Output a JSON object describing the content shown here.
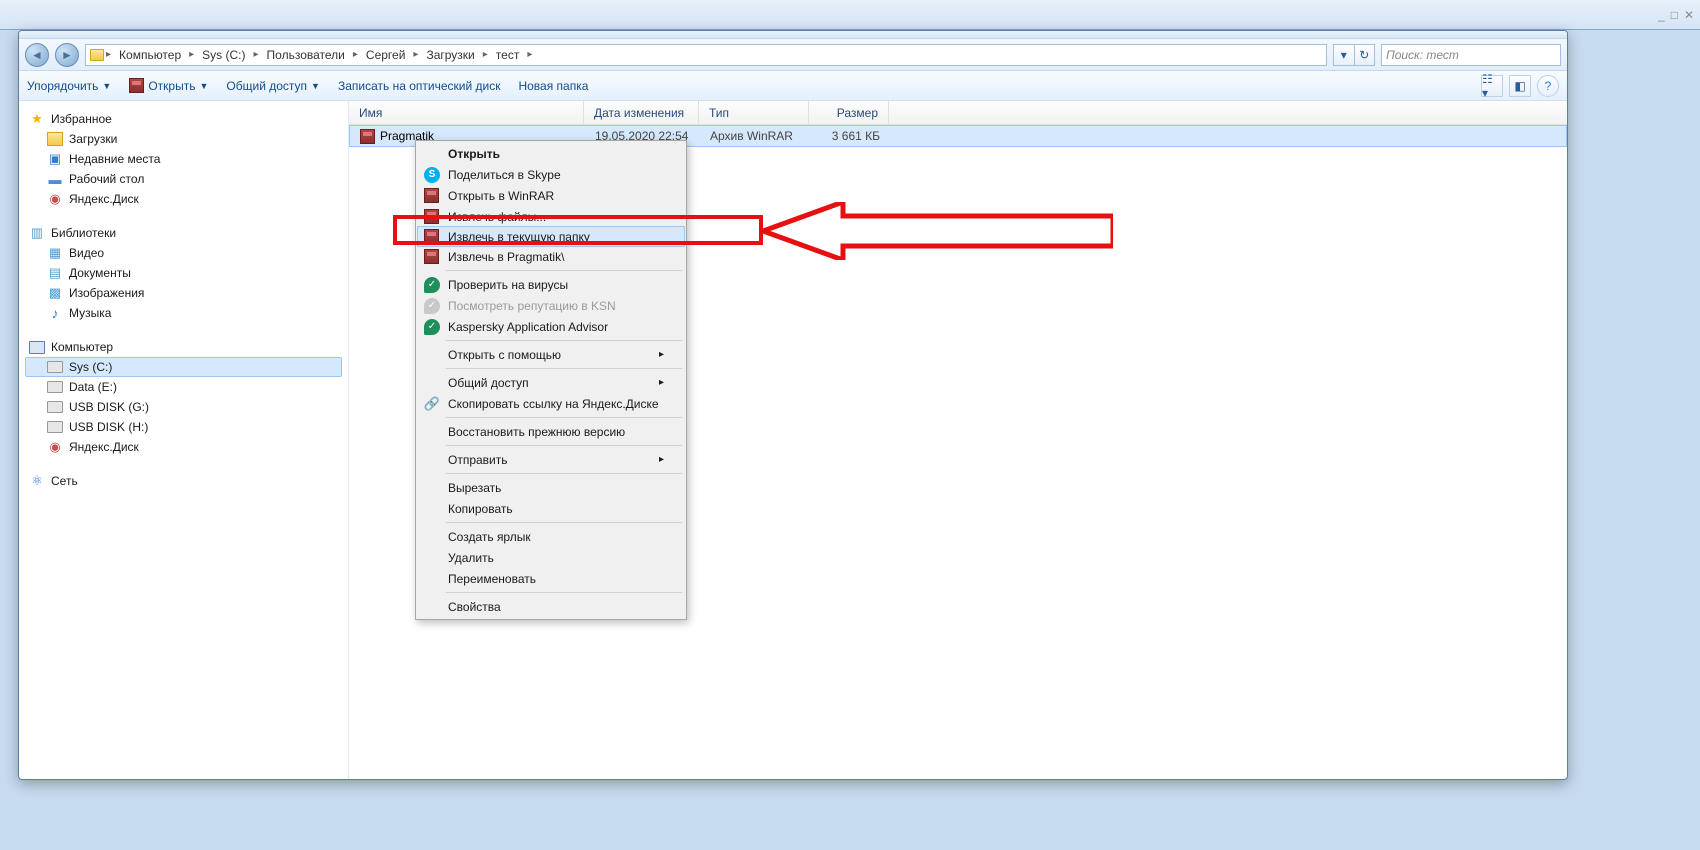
{
  "browserChrome": {
    "title": ""
  },
  "breadcrumb": {
    "items": [
      "Компьютер",
      "Sys (C:)",
      "Пользователи",
      "Сергей",
      "Загрузки",
      "тест"
    ]
  },
  "search": {
    "placeholder": "Поиск: тест"
  },
  "toolbar": {
    "organize": "Упорядочить",
    "open": "Открыть",
    "share": "Общий доступ",
    "burn": "Записать на оптический диск",
    "newfolder": "Новая папка"
  },
  "sidebar": {
    "favorites": {
      "label": "Избранное",
      "items": [
        "Загрузки",
        "Недавние места",
        "Рабочий стол",
        "Яндекс.Диск"
      ]
    },
    "libraries": {
      "label": "Библиотеки",
      "items": [
        "Видео",
        "Документы",
        "Изображения",
        "Музыка"
      ]
    },
    "computer": {
      "label": "Компьютер",
      "items": [
        "Sys (C:)",
        "Data (E:)",
        "USB DISK (G:)",
        "USB DISK (H:)",
        "Яндекс.Диск"
      ]
    },
    "network": {
      "label": "Сеть"
    }
  },
  "columns": {
    "name": "Имя",
    "date": "Дата изменения",
    "type": "Тип",
    "size": "Размер"
  },
  "files": [
    {
      "name": "Pragmatik",
      "date": "19.05.2020 22:54",
      "type": "Архив WinRAR",
      "size": "3 661 КБ"
    }
  ],
  "context": {
    "open": "Открыть",
    "skype": "Поделиться в Skype",
    "openrar": "Открыть в WinRAR",
    "extractfiles": "Извлечь файлы...",
    "extracthere": "Извлечь в текущую папку",
    "extractto": "Извлечь в Pragmatik\\",
    "scanvirus": "Проверить на вирусы",
    "ksn": "Посмотреть репутацию в KSN",
    "kaspadv": "Kaspersky Application Advisor",
    "openwith": "Открыть с помощью",
    "shareacc": "Общий доступ",
    "ydisklink": "Скопировать ссылку на Яндекс.Диске",
    "restorev": "Восстановить прежнюю версию",
    "sendto": "Отправить",
    "cut": "Вырезать",
    "copy": "Копировать",
    "shortcut": "Создать ярлык",
    "delete": "Удалить",
    "rename": "Переименовать",
    "props": "Свойства"
  }
}
